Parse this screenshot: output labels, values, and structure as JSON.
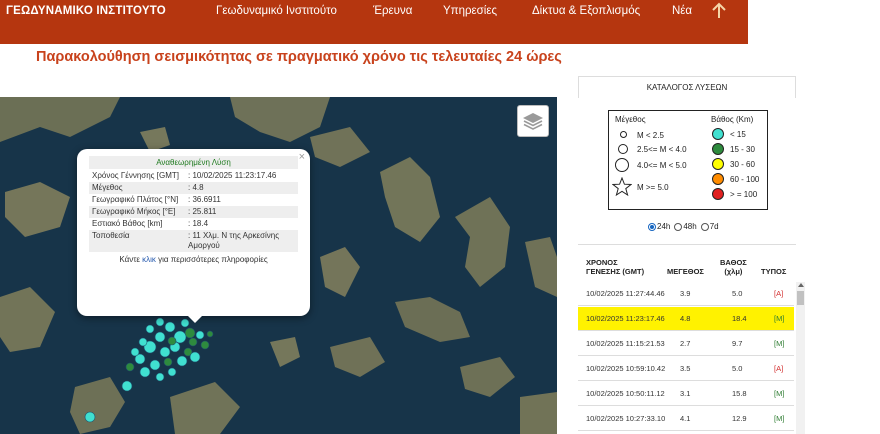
{
  "nav": {
    "brand": "ΓΕΩΔΥΝΑΜΙΚΟ ΙΝΣΤΙΤΟΥΤΟ",
    "links": [
      "Γεωδυναμικό Ινστιτούτο",
      "Έρευνα",
      "Υπηρεσίες",
      "Δίκτυα & Εξοπλισμός",
      "Νέα"
    ],
    "accent_color": "#b5360f"
  },
  "page": {
    "title": "Παρακολούθηση σεισμικότητας σε πραγματικό χρόνο τις τελευταίες 24 ώρες"
  },
  "popup": {
    "title": "Αναθεωρημένη Λύση",
    "close": "×",
    "rows": [
      {
        "label": "Χρόνος Γέννησης [GMT]",
        "value": ": 10/02/2025 11:23:17.46"
      },
      {
        "label": "Μέγεθος",
        "value": ": 4.8"
      },
      {
        "label": "Γεωγραφικό Πλάτος [°N]",
        "value": ": 36.6911"
      },
      {
        "label": "Γεωγραφικό Μήκος [°E]",
        "value": ": 25.811"
      },
      {
        "label": "Εστιακό Βάθος [km]",
        "value": ": 18.4"
      },
      {
        "label": "Τοποθεσία",
        "value": ": 11 Χλμ. Ν της Αρκεσίνης Αμοργού"
      }
    ],
    "footer_pre": "Κάντε ",
    "footer_link": "κλικ",
    "footer_post": " για περισσότερες πληροφορίες"
  },
  "catalog": {
    "title": "ΚΑΤΑΛΟΓΟΣ ΛΥΣΕΩΝ",
    "legend": {
      "magnitude_header": "Μέγεθος",
      "depth_header": "Βάθος (Km)",
      "magnitude_items": [
        "M < 2.5",
        "2.5<= M < 4.0",
        "4.0<= M < 5.0",
        "M >= 5.0"
      ],
      "depth_items": [
        {
          "label": "< 15",
          "color": "#40e0d0"
        },
        {
          "label": "15 - 30",
          "color": "#2e8b3e"
        },
        {
          "label": "30 - 60",
          "color": "#ffff00"
        },
        {
          "label": "60 - 100",
          "color": "#ff8c00"
        },
        {
          "label": "> = 100",
          "color": "#e02020"
        }
      ]
    },
    "periods": [
      {
        "label": "24h",
        "selected": true
      },
      {
        "label": "48h",
        "selected": false
      },
      {
        "label": "7d",
        "selected": false
      }
    ],
    "columns": {
      "time_l1": "ΧΡΟΝΟΣ",
      "time_l2": "ΓΕΝΕΣΗΣ (GMT)",
      "magnitude": "ΜΕΓΕΘΟΣ",
      "depth_l1": "ΒΑΘΟΣ",
      "depth_l2": "(χλμ)",
      "type": "ΤΥΠΟΣ"
    },
    "rows": [
      {
        "time": "10/02/2025 11:27:44.46",
        "mag": "3.9",
        "depth": "5.0",
        "type": "[A]",
        "highlight": false
      },
      {
        "time": "10/02/2025 11:23:17.46",
        "mag": "4.8",
        "depth": "18.4",
        "type": "[M]",
        "highlight": true
      },
      {
        "time": "10/02/2025 11:15:21.53",
        "mag": "2.7",
        "depth": "9.7",
        "type": "[M]",
        "highlight": false
      },
      {
        "time": "10/02/2025 10:59:10.42",
        "mag": "3.5",
        "depth": "5.0",
        "type": "[A]",
        "highlight": false
      },
      {
        "time": "10/02/2025 10:50:11.12",
        "mag": "3.1",
        "depth": "15.8",
        "type": "[M]",
        "highlight": false
      },
      {
        "time": "10/02/2025 10:27:33.10",
        "mag": "4.1",
        "depth": "12.9",
        "type": "[M]",
        "highlight": false
      }
    ]
  }
}
